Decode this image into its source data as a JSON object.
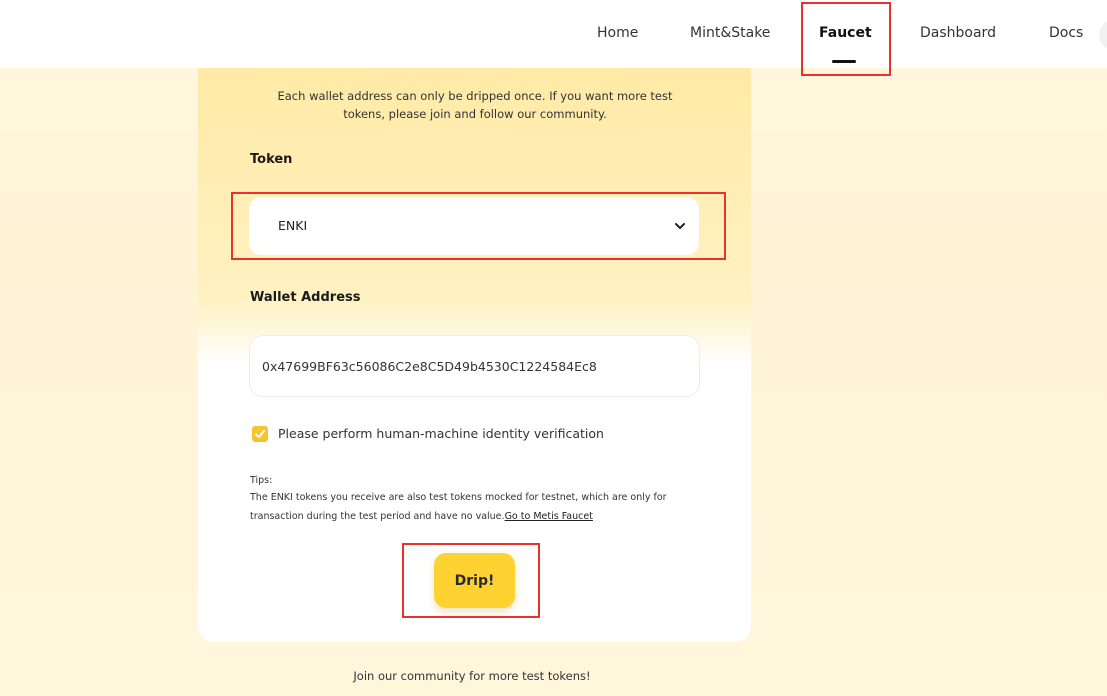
{
  "nav": {
    "items": [
      {
        "label": "Home"
      },
      {
        "label": "Mint&Stake"
      },
      {
        "label": "Faucet"
      },
      {
        "label": "Dashboard"
      },
      {
        "label": "Docs"
      }
    ],
    "active": "Faucet"
  },
  "card": {
    "intro": "Each wallet address can only be dripped once. If you want more test tokens, please join and follow our community.",
    "token_label": "Token",
    "token_value": "ENKI",
    "wallet_label": "Wallet Address",
    "wallet_value": "0x47699BF63c56086C2e8C5D49b4530C1224584Ec8",
    "verify_label": "Please perform human-machine identity verification",
    "verify_checked": true,
    "tips_heading": "Tips:",
    "tips_body": "The ENKI tokens you receive are also test tokens mocked for testnet, which are only for transaction during the test period and have no value.",
    "tips_link": "Go to Metis Faucet",
    "drip_label": "Drip!"
  },
  "footer": {
    "community_text": "Join our community for more test tokens!"
  },
  "colors": {
    "accent": "#fdd231",
    "checkbox": "#f5c531",
    "annotation": "#e8322b"
  }
}
